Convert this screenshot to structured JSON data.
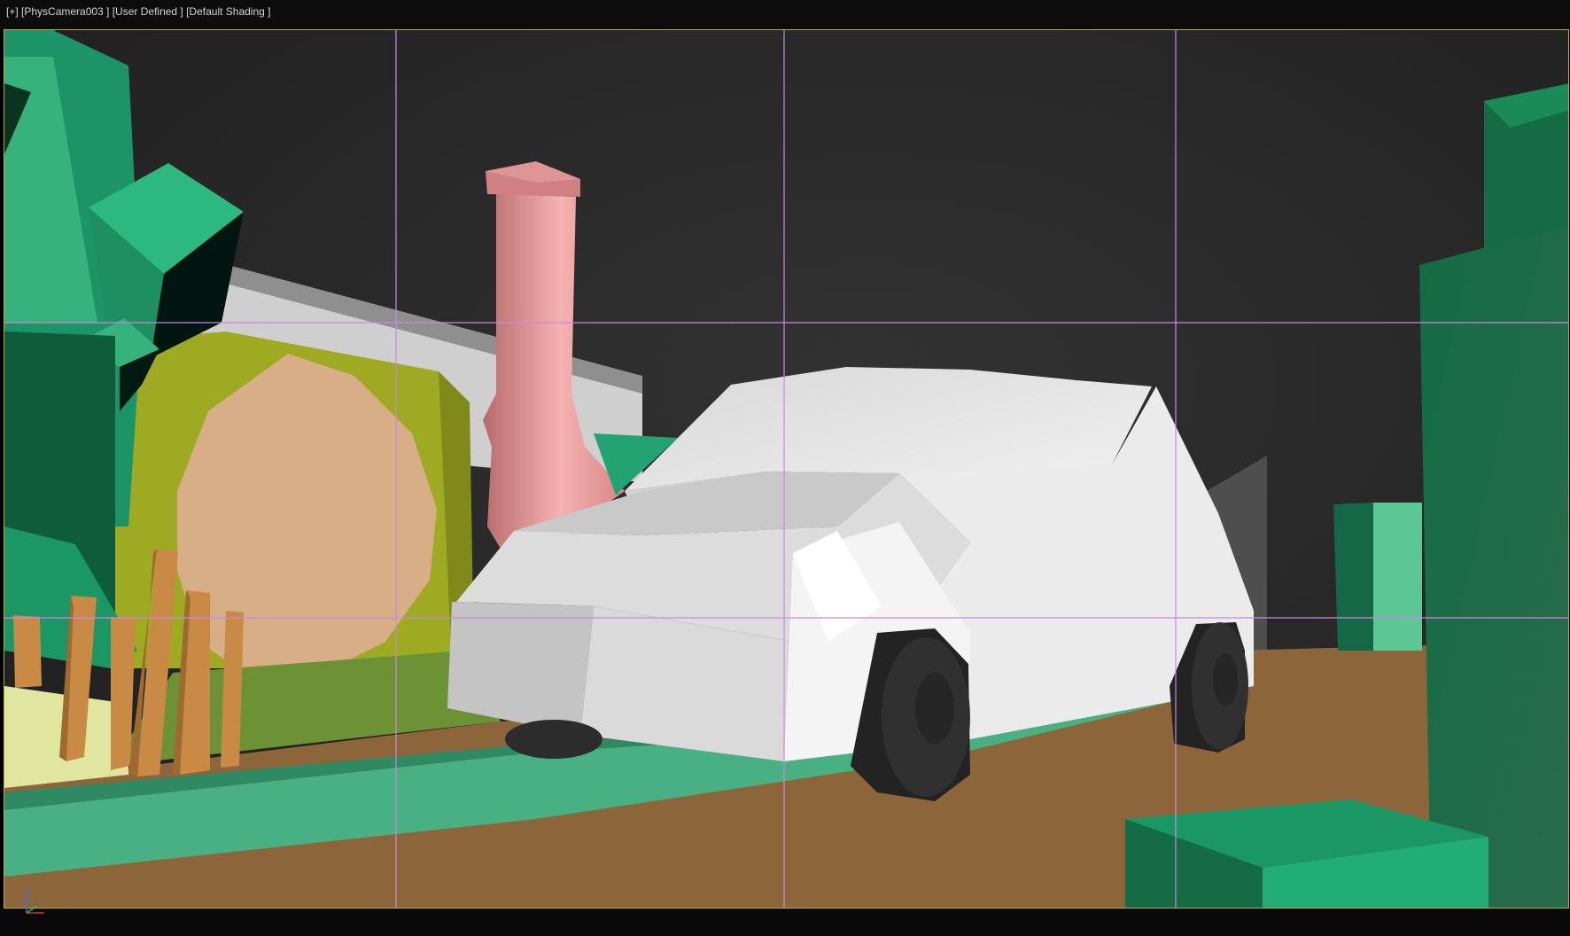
{
  "viewport": {
    "label": "[+] [PhysCamera003 ] [User Defined ] [Default Shading ]",
    "menu_plus": "[+]",
    "camera": "[PhysCamera003 ]",
    "view_mode": "[User Defined ]",
    "shading": "[Default Shading ]"
  },
  "colors": {
    "background_dark": "#262626",
    "grid_line": "#c98ad6",
    "frame_border": "#b8a83e",
    "car_white": "#e6e6e6",
    "tire": "#2c2c2c",
    "chimney": "#d88888",
    "door": "#d8ae86",
    "door_ring": "#9eaa22",
    "ground": "#8c663a",
    "stream": "#3c9a74",
    "foliage": "#22ad78",
    "fence": "#c88a44"
  },
  "icons": [
    "axis-gizmo-icon"
  ]
}
